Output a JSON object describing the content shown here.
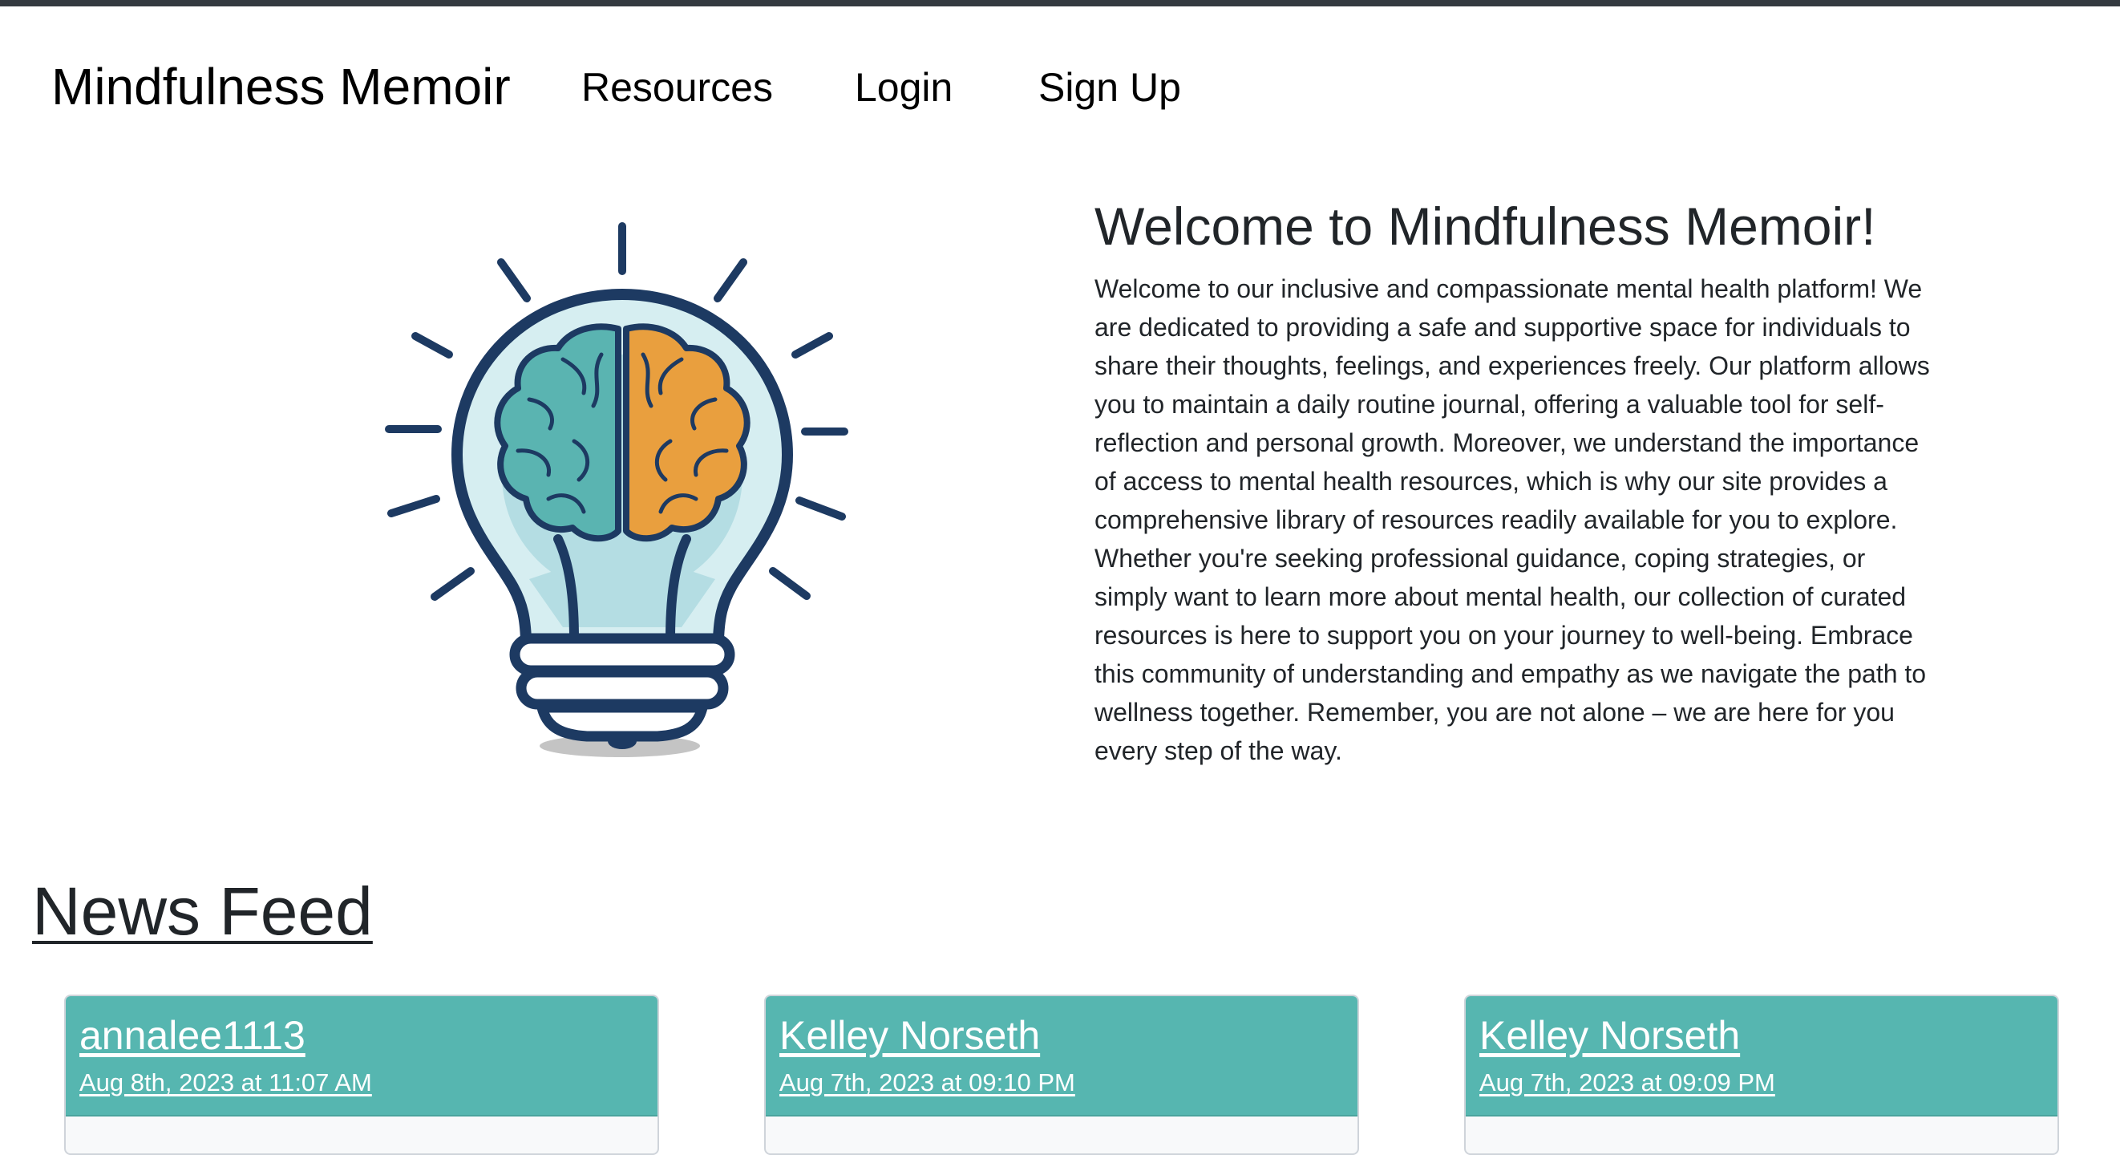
{
  "nav": {
    "brand": "Mindfulness Memoir",
    "links": [
      "Resources",
      "Login",
      "Sign Up"
    ]
  },
  "hero": {
    "image_icon": "lightbulb-brain-icon",
    "title": "Welcome to Mindfulness Memoir!",
    "body": "Welcome to our inclusive and compassionate mental health platform! We are dedicated to providing a safe and supportive space for individuals to share their thoughts, feelings, and experiences freely. Our platform allows you to maintain a daily routine journal, offering a valuable tool for self-reflection and personal growth. Moreover, we understand the importance of access to mental health resources, which is why our site provides a comprehensive library of resources readily available for you to explore. Whether you're seeking professional guidance, coping strategies, or simply want to learn more about mental health, our collection of curated resources is here to support you on your journey to well-being. Embrace this community of understanding and empathy as we navigate the path to wellness together. Remember, you are not alone – we are here for you every step of the way."
  },
  "news_feed": {
    "title": "News Feed",
    "posts": [
      {
        "user": "annalee1113",
        "date": "Aug 8th, 2023 at 11:07 AM"
      },
      {
        "user": "Kelley Norseth",
        "date": "Aug 7th, 2023 at 09:10 PM"
      },
      {
        "user": "Kelley Norseth",
        "date": "Aug 7th, 2023 at 09:09 PM"
      }
    ]
  },
  "colors": {
    "top_bar": "#343a40",
    "card_header": "#56b6b0",
    "brain_left": "#5ab4b1",
    "brain_right": "#e99f3e",
    "bulb_outline": "#1d3a62"
  }
}
